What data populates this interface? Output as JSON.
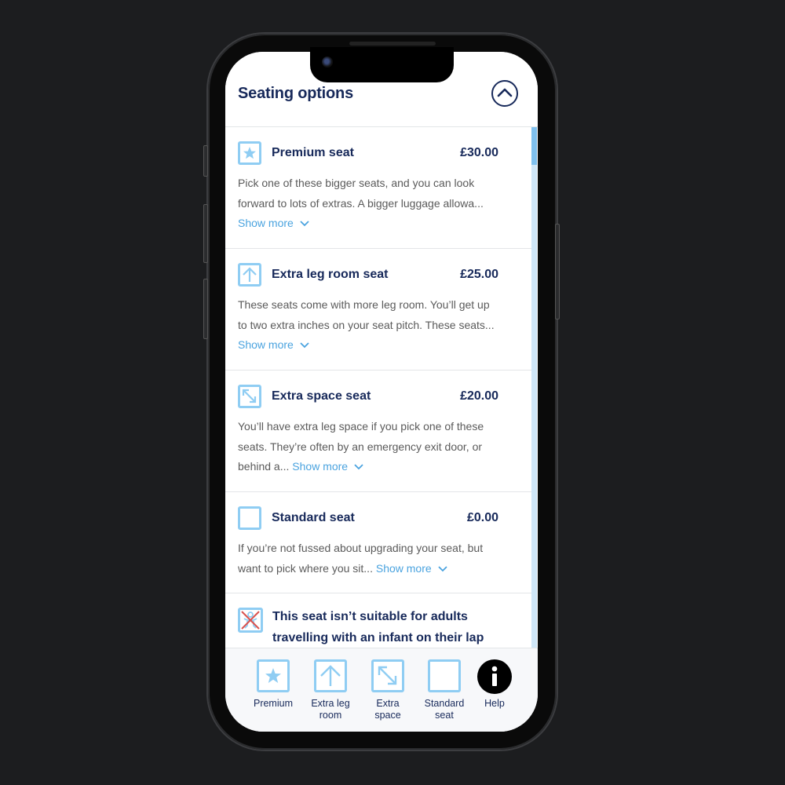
{
  "header": {
    "title": "Seating options",
    "collapse_icon": "chevron-up-circle-icon"
  },
  "options": [
    {
      "icon": "star-icon",
      "name": "Premium seat",
      "price": "£30.00",
      "description": "Pick one of these bigger seats, and you can look forward to lots of extras. A bigger luggage allowa...",
      "show_more": "Show more"
    },
    {
      "icon": "arrow-up-icon",
      "name": "Extra leg room seat",
      "price": "£25.00",
      "description": "These seats come with more leg room. You’ll get up to two extra inches on your seat pitch. These seats...",
      "show_more": "Show more"
    },
    {
      "icon": "arrow-diagonal-icon",
      "name": "Extra space seat",
      "price": "£20.00",
      "description": "You’ll have extra leg space if you pick one of these seats. They’re often by an emergency exit door, or behind a...",
      "show_more": "Show more"
    },
    {
      "icon": "empty-seat-icon",
      "name": "Standard seat",
      "price": "£0.00",
      "description": "If you’re not fussed about upgrading your seat, but want to pick where you sit...",
      "show_more": "Show more"
    }
  ],
  "warning": {
    "icon": "no-infant-icon",
    "text": "This seat isn’t suitable for adults travelling with an infant on their lap"
  },
  "legend": [
    {
      "icon": "star-icon",
      "label": "Premium"
    },
    {
      "icon": "arrow-up-icon",
      "label": "Extra leg room"
    },
    {
      "icon": "arrow-diagonal-icon",
      "label": "Extra space"
    },
    {
      "icon": "empty-seat-icon",
      "label": "Standard seat"
    },
    {
      "icon": "info-icon",
      "label": "Help"
    }
  ],
  "colors": {
    "navy": "#17295a",
    "accent_blue": "#4aa3df",
    "icon_blue": "#8fcdf3"
  }
}
